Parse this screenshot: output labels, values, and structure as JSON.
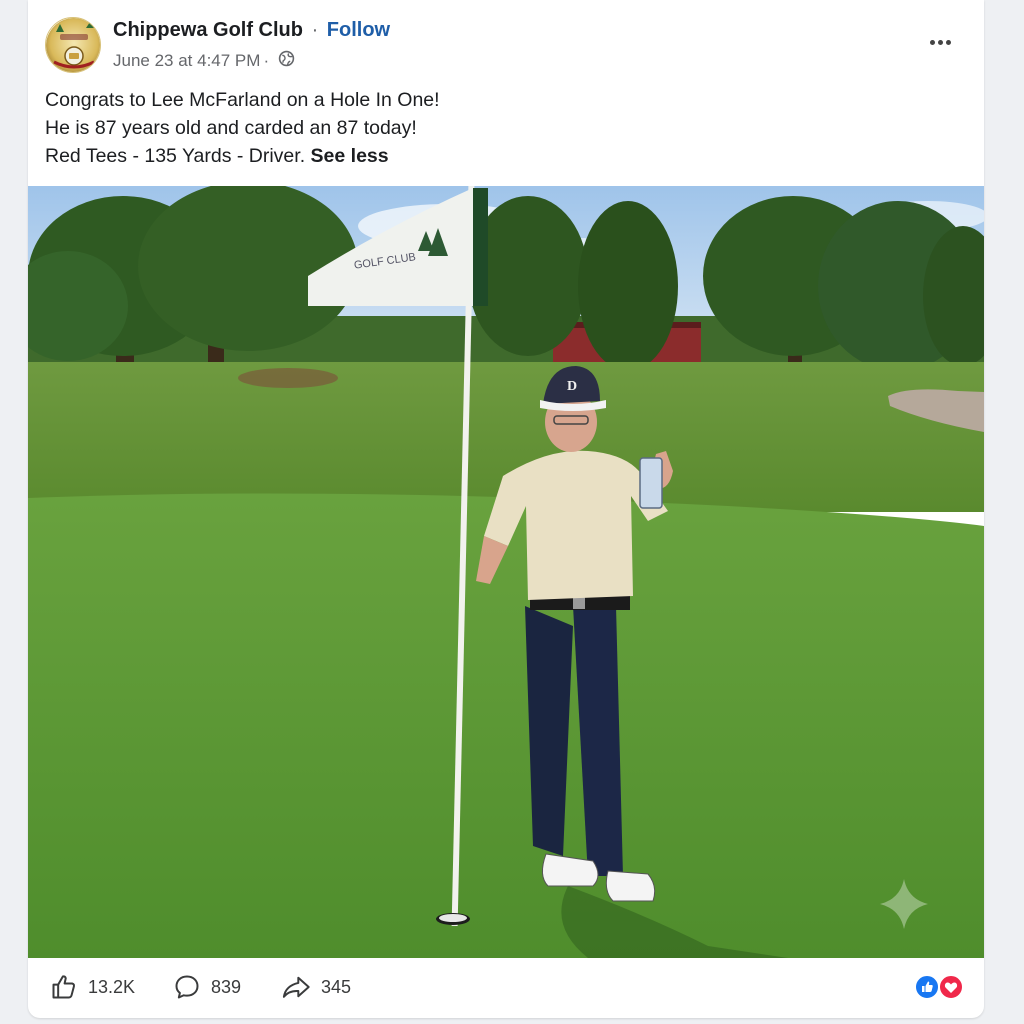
{
  "post": {
    "page_name": "Chippewa Golf Club",
    "separator": "·",
    "follow_label": "Follow",
    "timestamp": "June 23 at 4:47 PM",
    "meta_separator": "·",
    "visibility_icon": "globe-icon",
    "more_icon": "more-options-icon",
    "avatar_icon": "club-logo-avatar",
    "text_lines": [
      "Congrats to Lee McFarland on a Hole In One!",
      "He is 87 years old and carded an 87 today!",
      "Red Tees - 135 Yards - Driver."
    ],
    "see_less_label": "See less"
  },
  "photo": {
    "flag_text": "GOLF CLUB",
    "cap_letter": "D"
  },
  "footer": {
    "like_count": "13.2K",
    "comment_count": "839",
    "share_count": "345",
    "like_icon": "thumbs-up-icon",
    "comment_icon": "comment-bubble-icon",
    "share_icon": "share-arrow-icon",
    "reaction_icons": [
      "like-reaction-icon",
      "love-reaction-icon"
    ]
  },
  "colors": {
    "follow_link": "#1f5ea8",
    "like_reaction": "#1877f2",
    "love_reaction": "#f0284a",
    "grass": "#5f9a3a"
  }
}
